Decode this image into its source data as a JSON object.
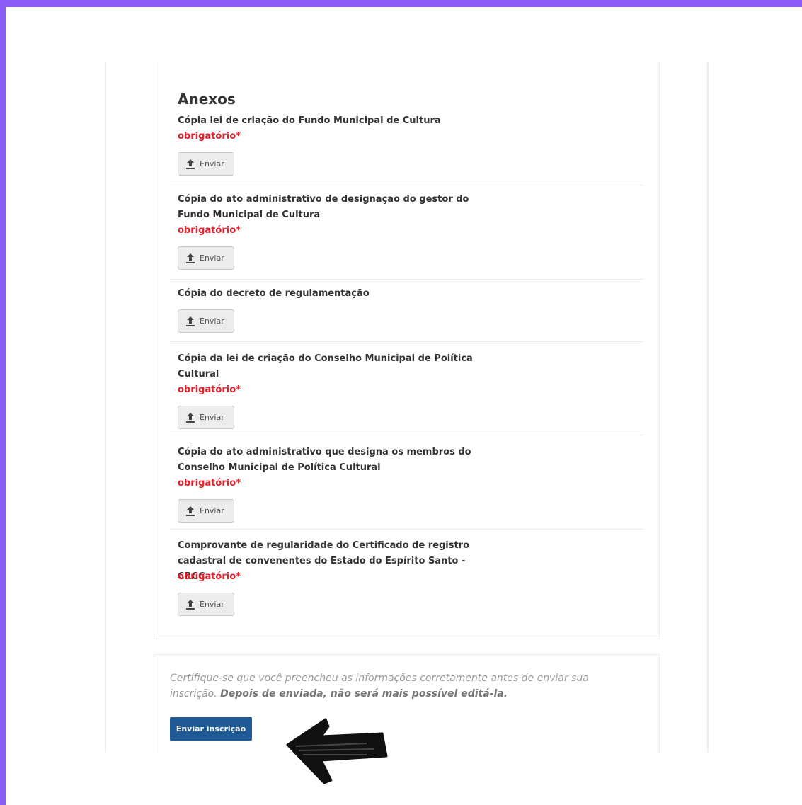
{
  "anexos": {
    "title": "Anexos",
    "button_label": "Enviar",
    "required_label": "obrigatório*",
    "items": [
      {
        "label": "Cópia lei de criação do Fundo Municipal de Cultura",
        "required": true
      },
      {
        "label": "Cópia do ato administrativo de designação do gestor do Fundo Municipal de Cultura",
        "required": true
      },
      {
        "label": "Cópia do decreto de regulamentação",
        "required": false
      },
      {
        "label": "Cópia da lei de criação do Conselho Municipal de Política Cultural",
        "required": true
      },
      {
        "label": "Cópia do ato administrativo que designa os membros do Conselho Municipal de Política Cultural",
        "required": true
      },
      {
        "label": "Comprovante de regularidade do Certificado de registro cadastral de convenentes do Estado do Espírito Santo - CRCC",
        "required": true
      }
    ]
  },
  "footer": {
    "notice_normal": "Certifique-se que você preencheu as informações corretamente antes de enviar sua inscrição.",
    "notice_bold": "Depois de enviada, não será mais possível editá-la.",
    "submit_label": "Enviar inscrição"
  },
  "colors": {
    "frame": "#8b5cf6",
    "required": "#e8202a",
    "submit": "#1f5a96"
  },
  "icons": {
    "upload": "upload-icon",
    "annotation": "arrow-pointer-icon"
  }
}
